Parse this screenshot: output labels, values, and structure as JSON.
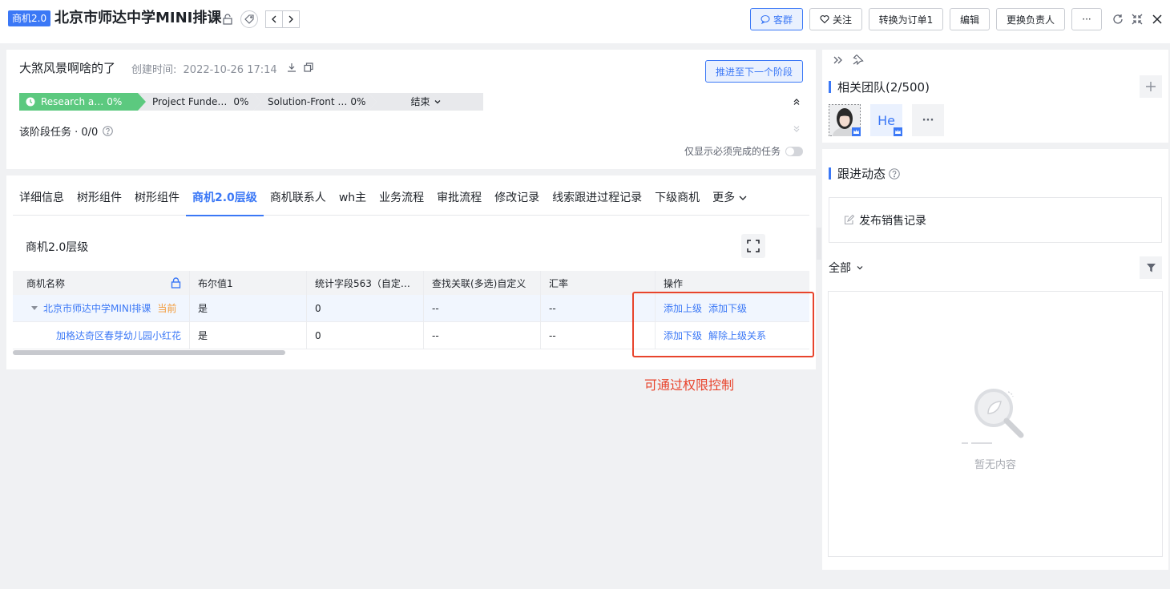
{
  "header": {
    "badge": "商机2.0",
    "title": "北京市师达中学MINI排课",
    "buttons": {
      "group_chat": "客群",
      "follow": "关注",
      "convert": "转换为订单1",
      "edit": "编辑",
      "change_owner": "更换负责人",
      "more": "···"
    }
  },
  "summary": {
    "name": "大煞风景啊啥的了",
    "created_label": "创建时间:",
    "created_value": "2022-10-26 17:14",
    "advance_button": "推进至下一个阶段",
    "stages": [
      {
        "label": "Research a…",
        "percent": "0%"
      },
      {
        "label": "Project Funde…",
        "percent": "0%"
      },
      {
        "label": "Solution-Front …",
        "percent": "0%"
      },
      {
        "label": "结束",
        "percent": ""
      }
    ],
    "stage_tasks": "该阶段任务 · 0/0",
    "only_required": "仅显示必须完成的任务"
  },
  "tabs": [
    "详细信息",
    "树形组件",
    "树形组件",
    "商机2.0层级",
    "商机联系人",
    "wh主",
    "业务流程",
    "审批流程",
    "修改记录",
    "线索跟进过程记录",
    "下级商机",
    "更多"
  ],
  "active_tab": "商机2.0层级",
  "hierarchy": {
    "title": "商机2.0层级",
    "columns": [
      "商机名称",
      "布尔值1",
      "统计字段563（自定…",
      "查找关联(多选)自定义",
      "汇率",
      "操作"
    ],
    "rows": [
      {
        "name": "北京市师达中学MINI排课",
        "current": "当前",
        "bool": "是",
        "stat": "0",
        "lookup": "--",
        "rate": "--",
        "actions": [
          "添加上级",
          "添加下级"
        ]
      },
      {
        "name": "加格达奇区春芽幼儿园小红花",
        "current": "",
        "bool": "是",
        "stat": "0",
        "lookup": "--",
        "rate": "--",
        "actions": [
          "添加下级",
          "解除上级关系"
        ]
      }
    ]
  },
  "annotation": "可通过权限控制",
  "team": {
    "title": "相关团队(2/500)",
    "member_initials": "He",
    "more": "···"
  },
  "activity": {
    "title": "跟进动态",
    "post_placeholder": "发布销售记录",
    "filter_label": "全部",
    "empty_text": "暂无内容"
  },
  "colors": {
    "accent": "#3b78f6",
    "stage_active": "#5cc97f",
    "annotation": "#e8442c"
  }
}
